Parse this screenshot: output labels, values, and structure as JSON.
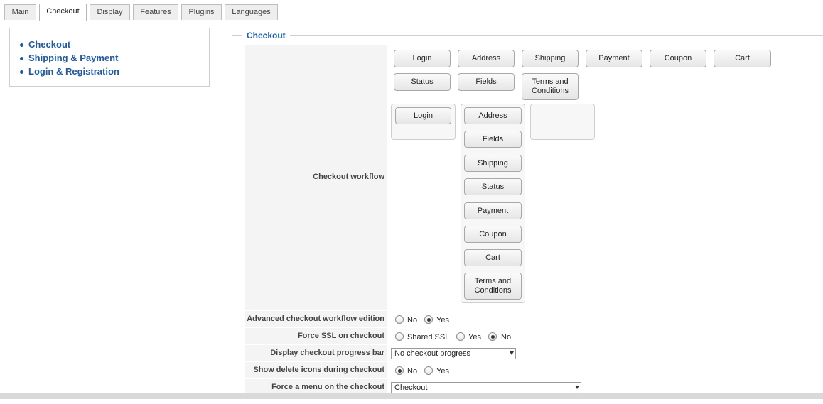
{
  "tabs": [
    {
      "label": "Main"
    },
    {
      "label": "Checkout",
      "active": true
    },
    {
      "label": "Display"
    },
    {
      "label": "Features"
    },
    {
      "label": "Plugins"
    },
    {
      "label": "Languages"
    }
  ],
  "sidebar": {
    "items": [
      {
        "label": "Checkout"
      },
      {
        "label": "Shipping & Payment"
      },
      {
        "label": "Login & Registration"
      }
    ]
  },
  "section": {
    "legend": "Checkout"
  },
  "workflow": {
    "label": "Checkout workflow",
    "palette": [
      "Login",
      "Address",
      "Shipping",
      "Payment",
      "Coupon",
      "Cart",
      "Status",
      "Fields",
      "Terms and Conditions"
    ],
    "step1": [
      "Login"
    ],
    "step2": [
      "Address",
      "Fields",
      "Shipping",
      "Status",
      "Payment",
      "Coupon",
      "Cart",
      "Terms and Conditions"
    ]
  },
  "advanced_edition": {
    "label": "Advanced checkout workflow edition",
    "options": [
      "No",
      "Yes"
    ],
    "selected": "Yes"
  },
  "force_ssl": {
    "label": "Force SSL on checkout",
    "options": [
      "Shared SSL",
      "Yes",
      "No"
    ],
    "selected": "No"
  },
  "progress_bar": {
    "label": "Display checkout progress bar",
    "value": "No checkout progress"
  },
  "delete_icons": {
    "label": "Show delete icons during checkout",
    "options": [
      "No",
      "Yes"
    ],
    "selected": "No"
  },
  "force_menu": {
    "label": "Force a menu on the checkout",
    "value": "Checkout"
  },
  "colors": {
    "link": "#1f5aa6",
    "label_bg": "#f4f4f4"
  }
}
